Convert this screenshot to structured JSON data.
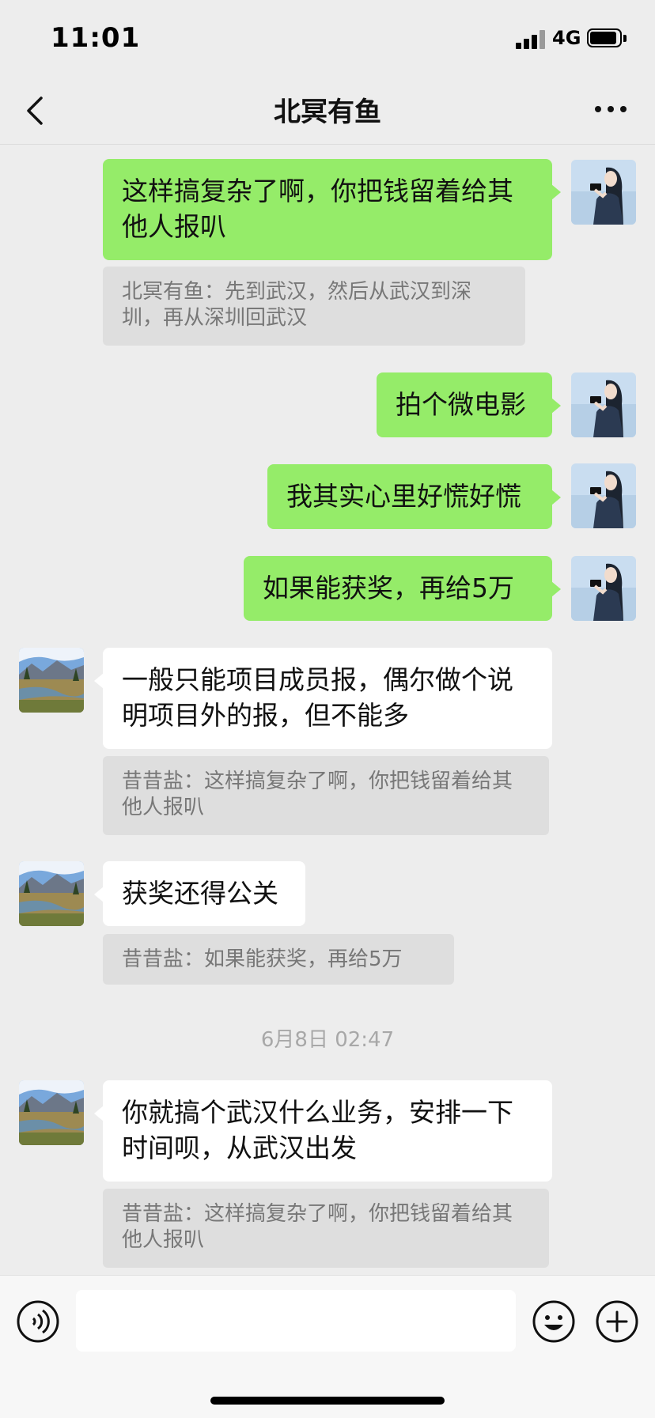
{
  "status_bar": {
    "time": "11:01",
    "network": "4G",
    "signal_icon": "cellular-signal-icon",
    "battery_icon": "battery-icon"
  },
  "nav": {
    "title": "北冥有鱼",
    "back_icon": "chevron-left-icon",
    "more_icon": "more-dots-icon"
  },
  "messages": [
    {
      "from": "me",
      "text": "这样搞复杂了啊，你把钱留着给其他人报叭",
      "avatar": "user-avatar-girl-camera",
      "quote": "北冥有鱼：先到武汉，然后从武汉到深圳，再从深圳回武汉"
    },
    {
      "from": "me",
      "text": "拍个微电影",
      "avatar": "user-avatar-girl-camera"
    },
    {
      "from": "me",
      "text": "我其实心里好慌好慌",
      "avatar": "user-avatar-girl-camera"
    },
    {
      "from": "me",
      "text": "如果能获奖，再给5万",
      "avatar": "user-avatar-girl-camera"
    },
    {
      "from": "other",
      "text": "一般只能项目成员报，偶尔做个说明项目外的报，但不能多",
      "avatar": "contact-avatar-landscape",
      "quote": "昔昔盐：这样搞复杂了啊，你把钱留着给其他人报叭"
    },
    {
      "from": "other",
      "text": "获奖还得公关",
      "avatar": "contact-avatar-landscape",
      "quote": "昔昔盐：如果能获奖，再给5万"
    },
    {
      "from": "timestamp",
      "text": "6月8日 02:47"
    },
    {
      "from": "other",
      "text": "你就搞个武汉什么业务，安排一下时间呗，从武汉出发",
      "avatar": "contact-avatar-landscape",
      "quote": "昔昔盐：这样搞复杂了啊，你把钱留着给其他人报叭"
    }
  ],
  "input_bar": {
    "voice_icon": "voice-icon",
    "text_value": "",
    "emoji_icon": "emoji-icon",
    "plus_icon": "plus-icon"
  },
  "colors": {
    "my_bubble": "#95ec69",
    "their_bubble": "#ffffff",
    "background": "#ededed",
    "quote_bg": "#dedede"
  }
}
